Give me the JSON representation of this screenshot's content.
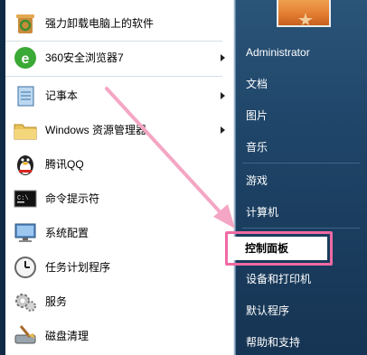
{
  "left_menu": {
    "items": [
      {
        "label": "强力卸载电脑上的软件",
        "icon": "recycle-bin-icon",
        "has_submenu": false
      },
      {
        "label": "360安全浏览器7",
        "icon": "browser-icon",
        "has_submenu": true
      },
      {
        "label": "记事本",
        "icon": "notepad-icon",
        "has_submenu": true
      },
      {
        "label": "Windows 资源管理器",
        "icon": "folder-icon",
        "has_submenu": true
      },
      {
        "label": "腾讯QQ",
        "icon": "qq-penguin-icon",
        "has_submenu": false
      },
      {
        "label": "命令提示符",
        "icon": "cmd-icon",
        "has_submenu": false
      },
      {
        "label": "系统配置",
        "icon": "system-config-icon",
        "has_submenu": false
      },
      {
        "label": "任务计划程序",
        "icon": "clock-icon",
        "has_submenu": false
      },
      {
        "label": "服务",
        "icon": "services-gear-icon",
        "has_submenu": false
      },
      {
        "label": "磁盘清理",
        "icon": "disk-cleanup-icon",
        "has_submenu": false
      }
    ]
  },
  "right_menu": {
    "user": "Administrator",
    "items": [
      {
        "label": "文档"
      },
      {
        "label": "图片"
      },
      {
        "label": "音乐"
      },
      {
        "label": "游戏"
      },
      {
        "label": "计算机"
      },
      {
        "label": "控制面板",
        "highlighted": true
      },
      {
        "label": "设备和打印机"
      },
      {
        "label": "默认程序"
      },
      {
        "label": "帮助和支持"
      }
    ]
  },
  "colors": {
    "highlight_border": "#f06aa3",
    "arrow": "#f4a6c4"
  }
}
